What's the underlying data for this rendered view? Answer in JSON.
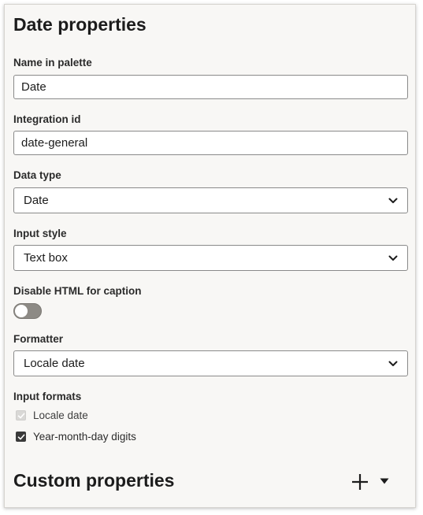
{
  "panel": {
    "title": "Date properties"
  },
  "fields": {
    "name_in_palette": {
      "label": "Name in palette",
      "value": "Date"
    },
    "integration_id": {
      "label": "Integration id",
      "value": "date-general"
    },
    "data_type": {
      "label": "Data type",
      "value": "Date"
    },
    "input_style": {
      "label": "Input style",
      "value": "Text box"
    },
    "disable_html": {
      "label": "Disable HTML for caption",
      "on": false
    },
    "formatter": {
      "label": "Formatter",
      "value": "Locale date"
    }
  },
  "input_formats": {
    "label": "Input formats",
    "options": [
      {
        "label": "Locale date",
        "checked": true,
        "disabled": true
      },
      {
        "label": "Year-month-day digits",
        "checked": true,
        "disabled": false
      }
    ]
  },
  "custom": {
    "title": "Custom properties",
    "add_icon": "plus-icon",
    "menu_icon": "caret-down-icon"
  },
  "colors": {
    "panel_bg": "#f8f7f5",
    "border": "#8a8a8a",
    "toggle_off": "#8d8a85",
    "check": "#3a3a3a"
  }
}
